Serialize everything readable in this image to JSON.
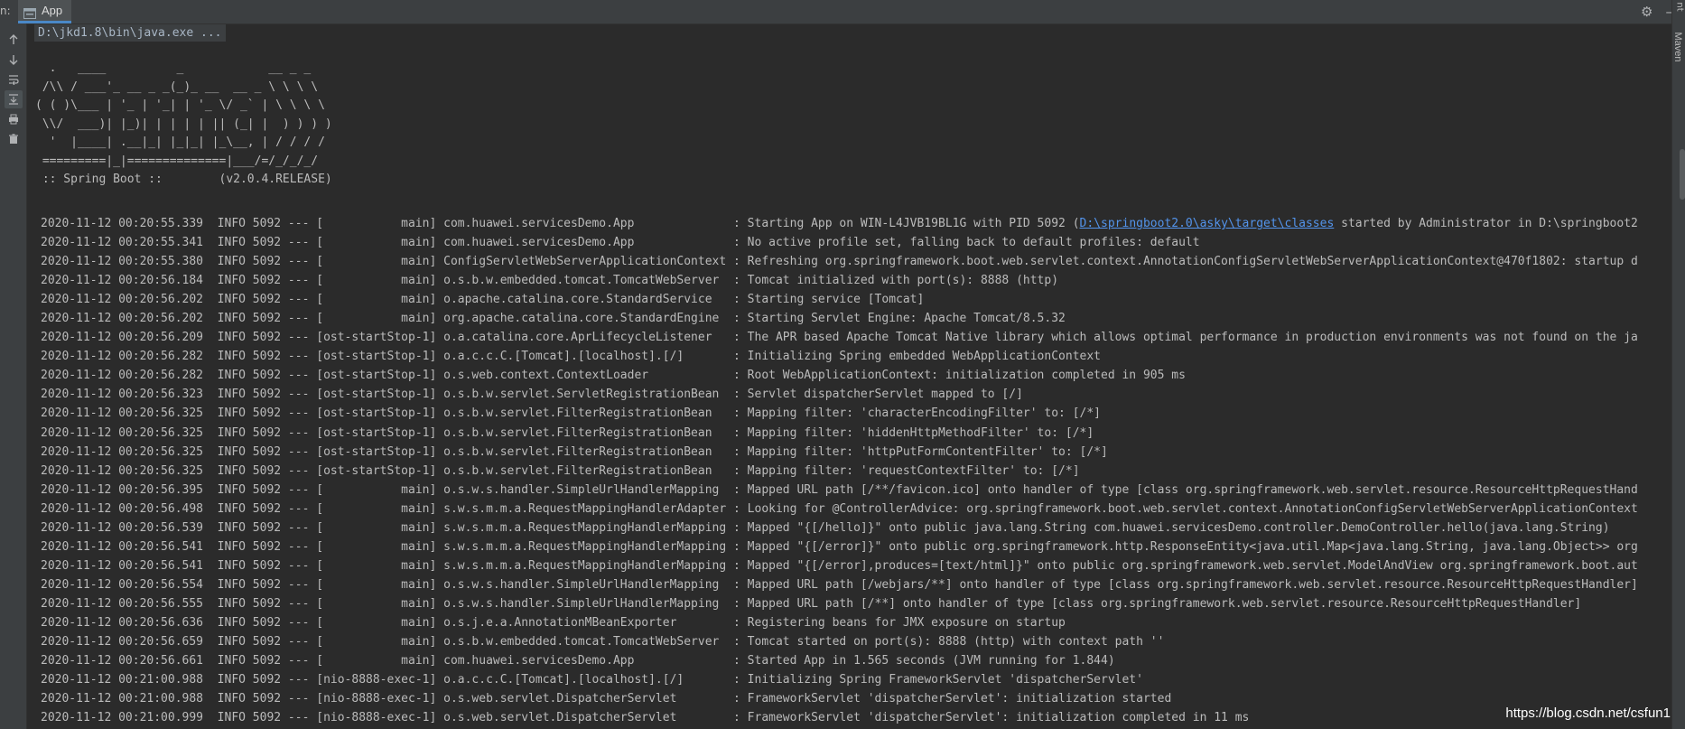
{
  "window": {
    "left_mark": "n:",
    "tab_label": "App",
    "right_strip_text": "Maven",
    "right_top_text": "nt",
    "settings_icon": "gear-icon",
    "hide_icon": "minimize-icon"
  },
  "toolbar": {
    "buttons": [
      "up-arrow-icon",
      "down-arrow-icon",
      "soft-wrap-icon",
      "scroll-to-end-icon",
      "print-icon",
      "trash-icon"
    ]
  },
  "console": {
    "command_line": "D:\\jkd1.8\\bin\\java.exe ...",
    "banner": "  .   ____          _            __ _ _\n /\\\\ / ___'_ __ _ _(_)_ __  __ _ \\ \\ \\ \\\n( ( )\\___ | '_ | '_| | '_ \\/ _` | \\ \\ \\ \\\n \\\\/  ___)| |_)| | | | | || (_| |  ) ) ) )\n  '  |____| .__|_| |_|_| |_\\__, | / / / /\n =========|_|==============|___/=/_/_/_/\n :: Spring Boot ::        (v2.0.4.RELEASE)",
    "log_lines": [
      {
        "text": "2020-11-12 00:20:55.339  INFO 5092 --- [           main] com.huawei.servicesDemo.App              : Starting App on WIN-L4JVB19BL1G with PID 5092 (",
        "link": "D:\\springboot2.0\\asky\\target\\classes",
        "after": " started by Administrator in D:\\springboot2"
      },
      {
        "text": "2020-11-12 00:20:55.341  INFO 5092 --- [           main] com.huawei.servicesDemo.App              : No active profile set, falling back to default profiles: default"
      },
      {
        "text": "2020-11-12 00:20:55.380  INFO 5092 --- [           main] ConfigServletWebServerApplicationContext : Refreshing org.springframework.boot.web.servlet.context.AnnotationConfigServletWebServerApplicationContext@470f1802: startup d"
      },
      {
        "text": "2020-11-12 00:20:56.184  INFO 5092 --- [           main] o.s.b.w.embedded.tomcat.TomcatWebServer  : Tomcat initialized with port(s): 8888 (http)"
      },
      {
        "text": "2020-11-12 00:20:56.202  INFO 5092 --- [           main] o.apache.catalina.core.StandardService   : Starting service [Tomcat]"
      },
      {
        "text": "2020-11-12 00:20:56.202  INFO 5092 --- [           main] org.apache.catalina.core.StandardEngine  : Starting Servlet Engine: Apache Tomcat/8.5.32"
      },
      {
        "text": "2020-11-12 00:20:56.209  INFO 5092 --- [ost-startStop-1] o.a.catalina.core.AprLifecycleListener   : The APR based Apache Tomcat Native library which allows optimal performance in production environments was not found on the ja"
      },
      {
        "text": "2020-11-12 00:20:56.282  INFO 5092 --- [ost-startStop-1] o.a.c.c.C.[Tomcat].[localhost].[/]       : Initializing Spring embedded WebApplicationContext"
      },
      {
        "text": "2020-11-12 00:20:56.282  INFO 5092 --- [ost-startStop-1] o.s.web.context.ContextLoader            : Root WebApplicationContext: initialization completed in 905 ms"
      },
      {
        "text": "2020-11-12 00:20:56.323  INFO 5092 --- [ost-startStop-1] o.s.b.w.servlet.ServletRegistrationBean  : Servlet dispatcherServlet mapped to [/]"
      },
      {
        "text": "2020-11-12 00:20:56.325  INFO 5092 --- [ost-startStop-1] o.s.b.w.servlet.FilterRegistrationBean   : Mapping filter: 'characterEncodingFilter' to: [/*]"
      },
      {
        "text": "2020-11-12 00:20:56.325  INFO 5092 --- [ost-startStop-1] o.s.b.w.servlet.FilterRegistrationBean   : Mapping filter: 'hiddenHttpMethodFilter' to: [/*]"
      },
      {
        "text": "2020-11-12 00:20:56.325  INFO 5092 --- [ost-startStop-1] o.s.b.w.servlet.FilterRegistrationBean   : Mapping filter: 'httpPutFormContentFilter' to: [/*]"
      },
      {
        "text": "2020-11-12 00:20:56.325  INFO 5092 --- [ost-startStop-1] o.s.b.w.servlet.FilterRegistrationBean   : Mapping filter: 'requestContextFilter' to: [/*]"
      },
      {
        "text": "2020-11-12 00:20:56.395  INFO 5092 --- [           main] o.s.w.s.handler.SimpleUrlHandlerMapping  : Mapped URL path [/**/favicon.ico] onto handler of type [class org.springframework.web.servlet.resource.ResourceHttpRequestHand"
      },
      {
        "text": "2020-11-12 00:20:56.498  INFO 5092 --- [           main] s.w.s.m.m.a.RequestMappingHandlerAdapter : Looking for @ControllerAdvice: org.springframework.boot.web.servlet.context.AnnotationConfigServletWebServerApplicationContext"
      },
      {
        "text": "2020-11-12 00:20:56.539  INFO 5092 --- [           main] s.w.s.m.m.a.RequestMappingHandlerMapping : Mapped \"{[/hello]}\" onto public java.lang.String com.huawei.servicesDemo.controller.DemoController.hello(java.lang.String)"
      },
      {
        "text": "2020-11-12 00:20:56.541  INFO 5092 --- [           main] s.w.s.m.m.a.RequestMappingHandlerMapping : Mapped \"{[/error]}\" onto public org.springframework.http.ResponseEntity<java.util.Map<java.lang.String, java.lang.Object>> org"
      },
      {
        "text": "2020-11-12 00:20:56.541  INFO 5092 --- [           main] s.w.s.m.m.a.RequestMappingHandlerMapping : Mapped \"{[/error],produces=[text/html]}\" onto public org.springframework.web.servlet.ModelAndView org.springframework.boot.aut"
      },
      {
        "text": "2020-11-12 00:20:56.554  INFO 5092 --- [           main] o.s.w.s.handler.SimpleUrlHandlerMapping  : Mapped URL path [/webjars/**] onto handler of type [class org.springframework.web.servlet.resource.ResourceHttpRequestHandler]"
      },
      {
        "text": "2020-11-12 00:20:56.555  INFO 5092 --- [           main] o.s.w.s.handler.SimpleUrlHandlerMapping  : Mapped URL path [/**] onto handler of type [class org.springframework.web.servlet.resource.ResourceHttpRequestHandler]"
      },
      {
        "text": "2020-11-12 00:20:56.636  INFO 5092 --- [           main] o.s.j.e.a.AnnotationMBeanExporter        : Registering beans for JMX exposure on startup"
      },
      {
        "text": "2020-11-12 00:20:56.659  INFO 5092 --- [           main] o.s.b.w.embedded.tomcat.TomcatWebServer  : Tomcat started on port(s): 8888 (http) with context path ''"
      },
      {
        "text": "2020-11-12 00:20:56.661  INFO 5092 --- [           main] com.huawei.servicesDemo.App              : Started App in 1.565 seconds (JVM running for 1.844)"
      },
      {
        "text": "2020-11-12 00:21:00.988  INFO 5092 --- [nio-8888-exec-1] o.a.c.c.C.[Tomcat].[localhost].[/]       : Initializing Spring FrameworkServlet 'dispatcherServlet'"
      },
      {
        "text": "2020-11-12 00:21:00.988  INFO 5092 --- [nio-8888-exec-1] o.s.web.servlet.DispatcherServlet        : FrameworkServlet 'dispatcherServlet': initialization started"
      },
      {
        "text": "2020-11-12 00:21:00.999  INFO 5092 --- [nio-8888-exec-1] o.s.web.servlet.DispatcherServlet        : FrameworkServlet 'dispatcherServlet': initialization completed in 11 ms"
      }
    ]
  },
  "watermark": "https://blog.csdn.net/csfun1",
  "colors": {
    "background": "#2b2b2b",
    "toolbar": "#3c3f41",
    "text": "#bbbbbb",
    "link": "#5394ec",
    "tab_accent": "#4a88c7"
  }
}
